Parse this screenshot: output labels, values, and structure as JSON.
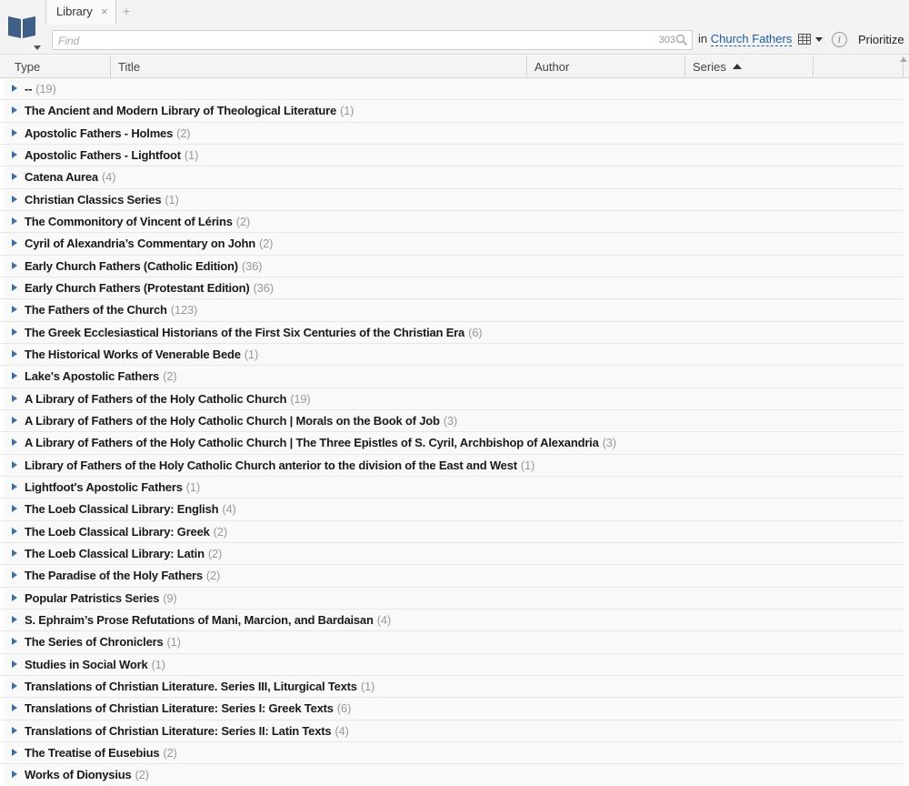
{
  "tab": {
    "label": "Library",
    "close": "×",
    "add": "+"
  },
  "search": {
    "placeholder": "Find",
    "count": "303",
    "scope_prefix": "in",
    "scope": "Church Fathers"
  },
  "toolbar": {
    "info": "i",
    "prioritize": "Prioritize"
  },
  "columns": [
    {
      "label": "Type"
    },
    {
      "label": "Title"
    },
    {
      "label": "Author"
    },
    {
      "label": "Series",
      "sorted": "ascending"
    },
    {
      "label": ""
    }
  ],
  "colors": {
    "accent": "#1f5e9c",
    "expand_arrow": "#3e6fa3",
    "count_text": "#999999"
  },
  "groups": [
    {
      "label": "--",
      "count": "(19)"
    },
    {
      "label": "The Ancient and Modern Library of Theological Literature",
      "count": "(1)"
    },
    {
      "label": "Apostolic Fathers - Holmes",
      "count": "(2)"
    },
    {
      "label": "Apostolic Fathers - Lightfoot",
      "count": "(1)"
    },
    {
      "label": "Catena Aurea",
      "count": "(4)"
    },
    {
      "label": "Christian Classics Series",
      "count": "(1)"
    },
    {
      "label": "The Commonitory of Vincent of Lérins",
      "count": "(2)"
    },
    {
      "label": "Cyril of Alexandria’s Commentary on John",
      "count": "(2)"
    },
    {
      "label": "Early Church Fathers (Catholic Edition)",
      "count": "(36)"
    },
    {
      "label": "Early Church Fathers (Protestant Edition)",
      "count": "(36)"
    },
    {
      "label": "The Fathers of the Church",
      "count": "(123)"
    },
    {
      "label": "The Greek Ecclesiastical Historians of the First Six Centuries of the Christian Era",
      "count": "(6)"
    },
    {
      "label": "The Historical Works of Venerable Bede",
      "count": "(1)"
    },
    {
      "label": "Lake's Apostolic Fathers",
      "count": "(2)"
    },
    {
      "label": "A Library of Fathers of the Holy Catholic Church",
      "count": "(19)"
    },
    {
      "label": "A Library of Fathers of the Holy Catholic Church | Morals on the Book of Job",
      "count": "(3)"
    },
    {
      "label": "A Library of Fathers of the Holy Catholic Church | The Three Epistles of S. Cyril, Archbishop of Alexandria",
      "count": "(3)"
    },
    {
      "label": "Library of Fathers of the Holy Catholic Church anterior to the division of the East and West",
      "count": "(1)"
    },
    {
      "label": "Lightfoot's Apostolic Fathers",
      "count": "(1)"
    },
    {
      "label": "The Loeb Classical Library: English",
      "count": "(4)"
    },
    {
      "label": "The Loeb Classical Library: Greek",
      "count": "(2)"
    },
    {
      "label": "The Loeb Classical Library: Latin",
      "count": "(2)"
    },
    {
      "label": "The Paradise of the Holy Fathers",
      "count": "(2)"
    },
    {
      "label": "Popular Patristics Series",
      "count": "(9)"
    },
    {
      "label": "S. Ephraim’s Prose Refutations of Mani, Marcion, and Bardaisan",
      "count": "(4)"
    },
    {
      "label": "The Series of Chroniclers",
      "count": "(1)"
    },
    {
      "label": "Studies in Social Work",
      "count": "(1)"
    },
    {
      "label": "Translations of Christian Literature. Series III, Liturgical Texts",
      "count": "(1)"
    },
    {
      "label": "Translations of Christian Literature: Series I: Greek Texts",
      "count": "(6)"
    },
    {
      "label": "Translations of Christian Literature: Series II: Latin Texts",
      "count": "(4)"
    },
    {
      "label": "The Treatise of Eusebius",
      "count": "(2)"
    },
    {
      "label": "Works of Dionysius",
      "count": "(2)"
    }
  ]
}
